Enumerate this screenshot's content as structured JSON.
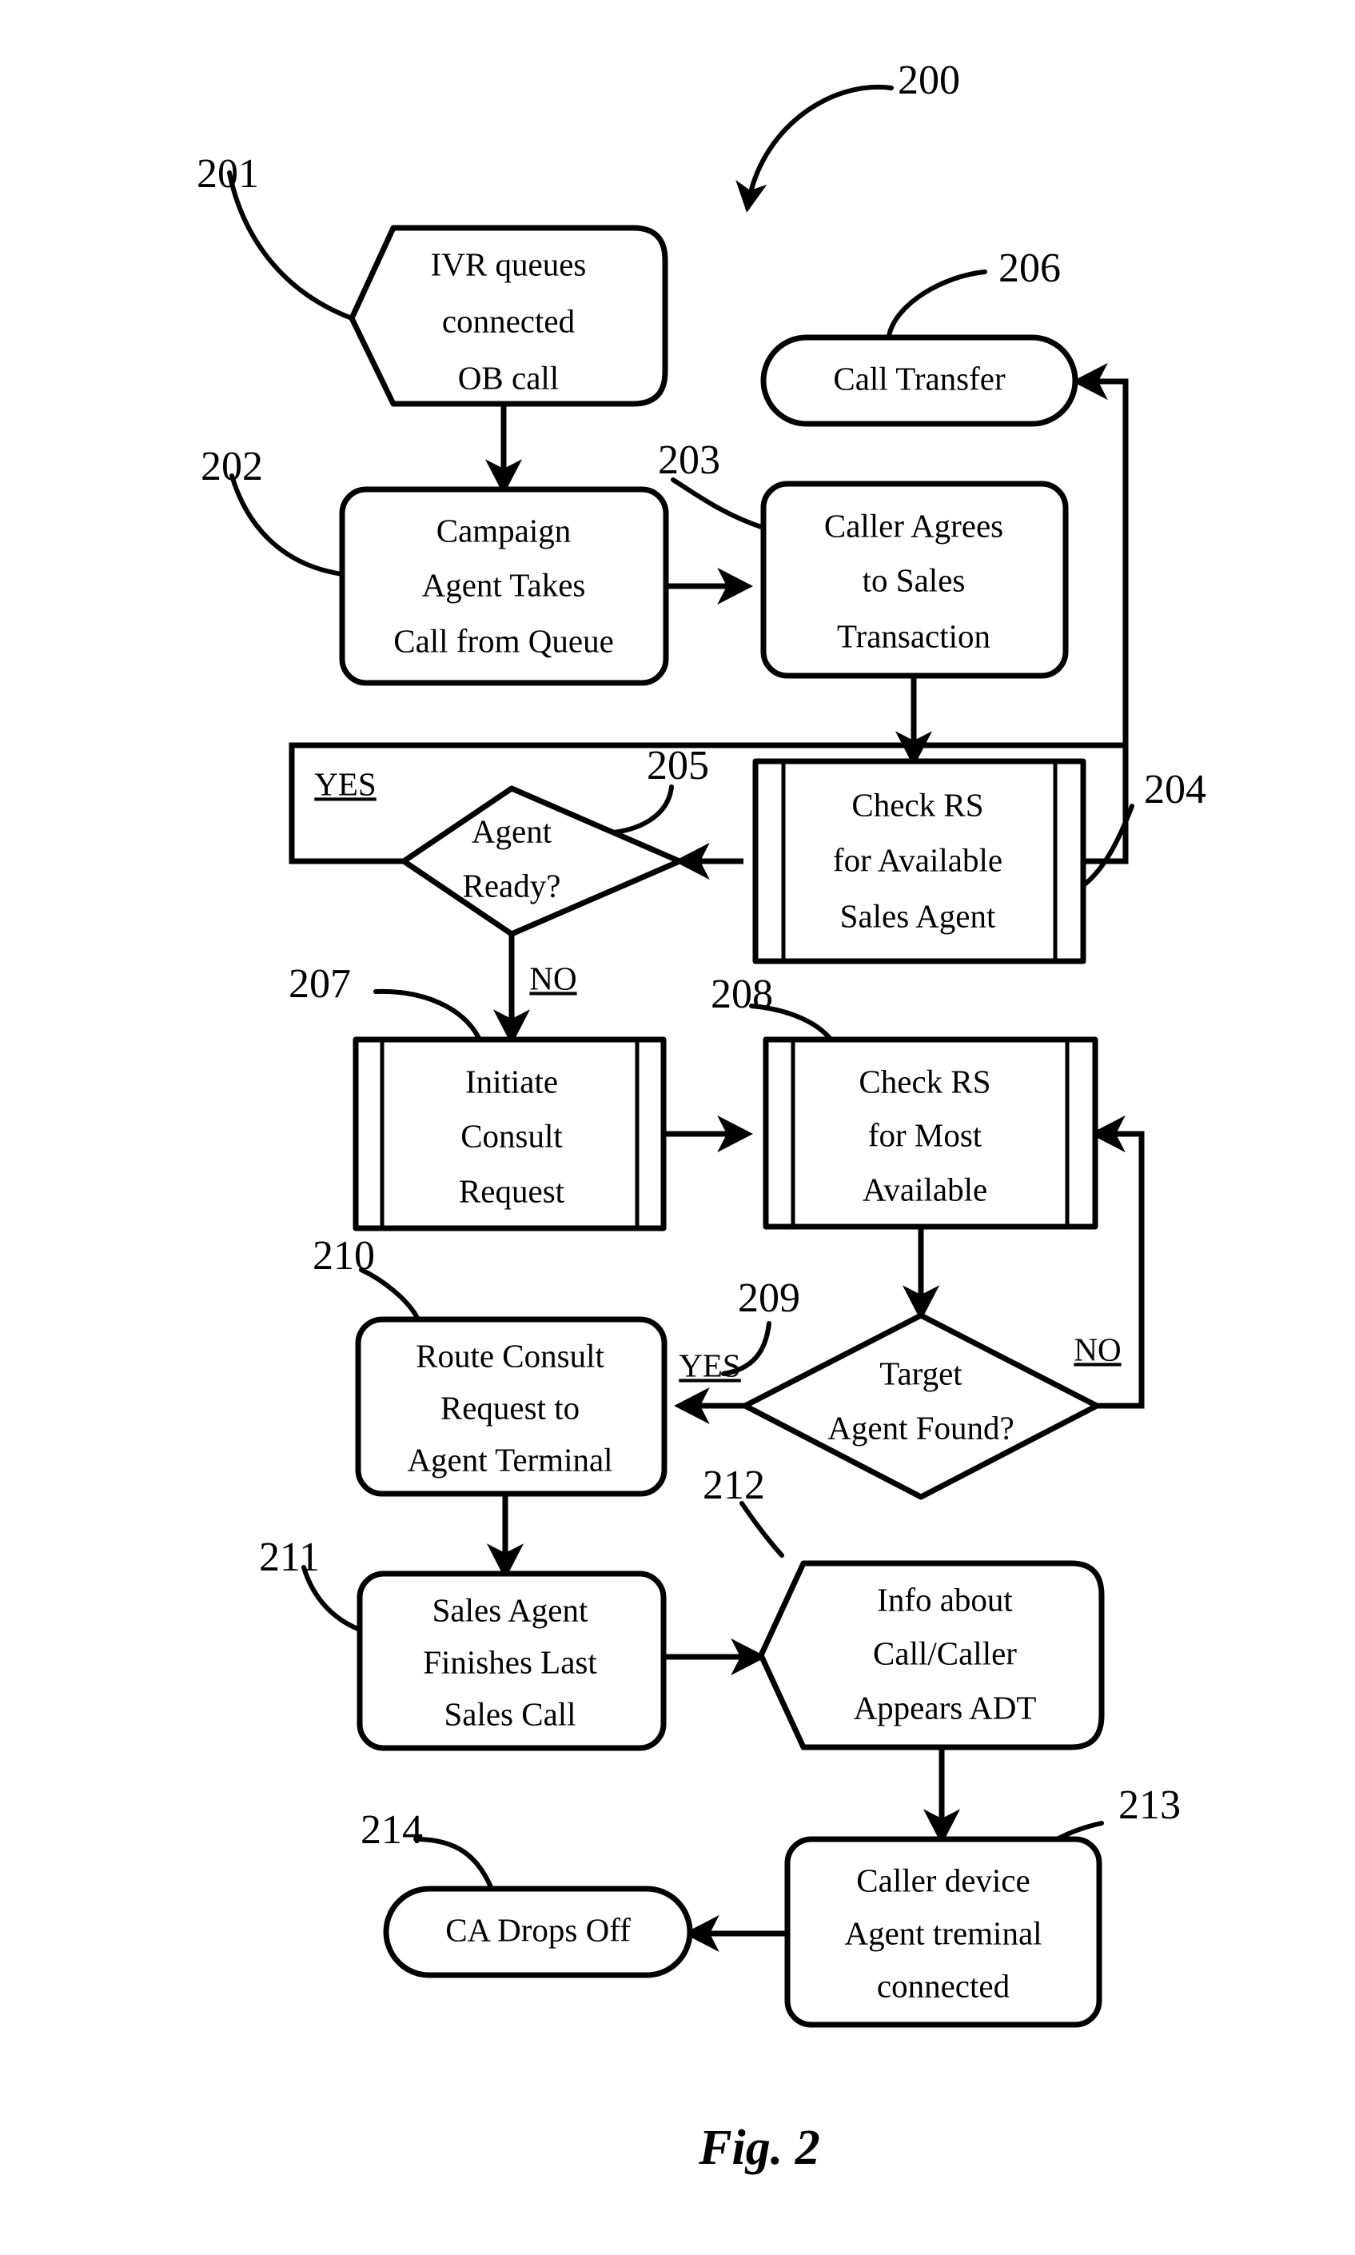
{
  "figure": {
    "caption": "Fig. 2",
    "diagram_reference": "200"
  },
  "nodes": [
    {
      "id": "201",
      "ref": "201",
      "shape": "pentagon-rounded-right",
      "lines": [
        "IVR queues",
        "connected",
        "OB call"
      ]
    },
    {
      "id": "206",
      "ref": "206",
      "shape": "stadium",
      "lines": [
        "Call Transfer"
      ]
    },
    {
      "id": "202",
      "ref": "202",
      "shape": "rounded-rect",
      "lines": [
        "Campaign",
        "Agent Takes",
        "Call from Queue"
      ]
    },
    {
      "id": "203",
      "ref": "203",
      "shape": "rounded-rect",
      "lines": [
        "Caller Agrees",
        "to Sales",
        "Transaction"
      ]
    },
    {
      "id": "204",
      "ref": "204",
      "shape": "predefined-process",
      "lines": [
        "Check RS",
        "for Available",
        "Sales Agent"
      ]
    },
    {
      "id": "205",
      "ref": "205",
      "shape": "diamond",
      "lines": [
        "Agent",
        "Ready?"
      ]
    },
    {
      "id": "207",
      "ref": "207",
      "shape": "predefined-process",
      "lines": [
        "Initiate",
        "Consult",
        "Request"
      ]
    },
    {
      "id": "208",
      "ref": "208",
      "shape": "predefined-process",
      "lines": [
        "Check RS",
        "for Most",
        "Available"
      ]
    },
    {
      "id": "209",
      "ref": "209",
      "shape": "diamond",
      "lines": [
        "Target",
        "Agent Found?"
      ]
    },
    {
      "id": "210",
      "ref": "210",
      "shape": "rounded-rect",
      "lines": [
        "Route Consult",
        "Request to",
        "Agent Terminal"
      ]
    },
    {
      "id": "211",
      "ref": "211",
      "shape": "rounded-rect",
      "lines": [
        "Sales Agent",
        "Finishes Last",
        "Sales Call"
      ]
    },
    {
      "id": "212",
      "ref": "212",
      "shape": "pentagon-rounded-right",
      "lines": [
        "Info about",
        "Call/Caller",
        "Appears ADT"
      ]
    },
    {
      "id": "213",
      "ref": "213",
      "shape": "rounded-rect",
      "lines": [
        "Caller device",
        "Agent treminal",
        "connected"
      ]
    },
    {
      "id": "214",
      "ref": "214",
      "shape": "stadium",
      "lines": [
        "CA Drops Off"
      ]
    }
  ],
  "branch_labels": {
    "agent_ready_yes": "YES",
    "agent_ready_no": "NO",
    "target_found_yes": "YES",
    "target_found_no": "NO"
  },
  "colors": {
    "stroke": "#000000",
    "fill": "#ffffff",
    "background": "#ffffff"
  }
}
